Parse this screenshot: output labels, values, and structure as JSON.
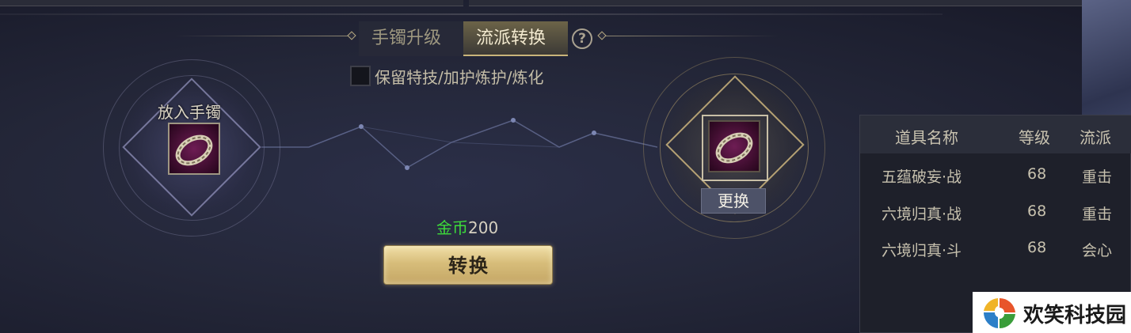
{
  "tabs": {
    "upgrade": "手镯升级",
    "style_convert": "流派转换",
    "help_icon": "question-mark"
  },
  "options": {
    "keep_label": "保留特技/加护炼护/炼化",
    "keep_checked": false
  },
  "input_socket": {
    "label": "放入手镯"
  },
  "output_socket": {
    "replace_label": "更换"
  },
  "cost": {
    "currency": "金币",
    "amount": "200"
  },
  "convert_button": {
    "label": "转换"
  },
  "table": {
    "headers": {
      "name": "道具名称",
      "level": "等级",
      "style": "流派"
    },
    "rows": [
      {
        "name": "五蕴破妄·战",
        "level": "68",
        "style": "重击"
      },
      {
        "name": "六境归真·战",
        "level": "68",
        "style": "重击"
      },
      {
        "name": "六境归真·斗",
        "level": "68",
        "style": "会心"
      }
    ]
  },
  "watermark": {
    "text": "欢笑科技园"
  },
  "colors": {
    "currency_green": "#3ddc3a",
    "button_gold": "#d7bd7a",
    "slot_purple": "#6e1d54"
  }
}
